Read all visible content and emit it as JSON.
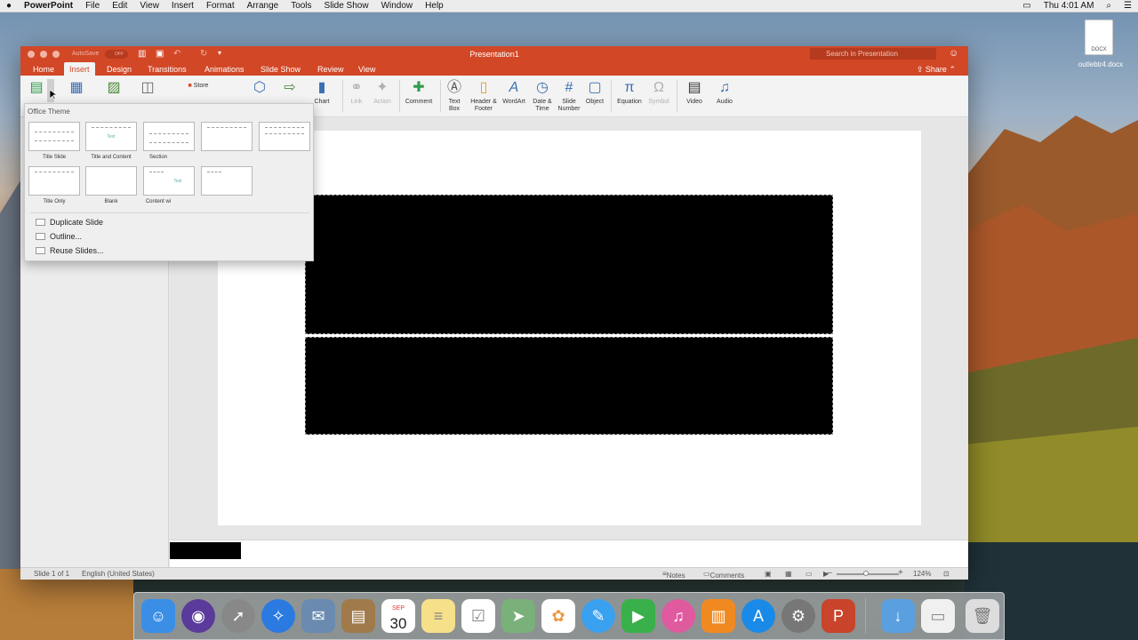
{
  "menubar": {
    "apple": "",
    "app": "PowerPoint",
    "items": [
      "File",
      "Edit",
      "View",
      "Insert",
      "Format",
      "Arrange",
      "Tools",
      "Slide Show",
      "Window",
      "Help"
    ],
    "time": "Thu 4:01 AM"
  },
  "window": {
    "title": "Presentation1",
    "autosave_label": "AutoSave",
    "autosave_state": "OFF",
    "search_placeholder": "Search in Presentation",
    "share_label": "Share",
    "accent": "#d24726"
  },
  "tabs": [
    {
      "label": "Home"
    },
    {
      "label": "Insert",
      "active": true
    },
    {
      "label": "Design"
    },
    {
      "label": "Transitions"
    },
    {
      "label": "Animations"
    },
    {
      "label": "Slide Show"
    },
    {
      "label": "Review"
    },
    {
      "label": "View"
    }
  ],
  "ribbon": {
    "store": "Store",
    "chart": "Chart",
    "link": "Link",
    "action": "Action",
    "comment": "Comment",
    "textbox": "Text\nBox",
    "textbox_l1": "Text",
    "textbox_l2": "Box",
    "header_l1": "Header &",
    "header_l2": "Footer",
    "wordart": "WordArt",
    "datetime_l1": "Date &",
    "datetime_l2": "Time",
    "slidenum_l1": "Slide",
    "slidenum_l2": "Number",
    "object": "Object",
    "equation": "Equation",
    "symbol": "Symbol",
    "video": "Video",
    "audio": "Audio"
  },
  "dropdown": {
    "title": "Office Theme",
    "layouts": [
      {
        "label": "Title Slide"
      },
      {
        "label": "Title and Content",
        "text": "Text"
      },
      {
        "label": "Section"
      },
      {
        "label": ""
      },
      {
        "label": ""
      },
      {
        "label": "Title Only"
      },
      {
        "label": "Blank"
      },
      {
        "label": "Content wi",
        "text": "Text"
      },
      {
        "label": ""
      }
    ],
    "actions": [
      "Duplicate Slide",
      "Outline...",
      "Reuse Slides..."
    ]
  },
  "status": {
    "slide": "Slide 1 of 1",
    "language": "English (United States)",
    "notes": "Notes",
    "comments": "Comments",
    "zoom": "124%"
  },
  "desktop": {
    "file_ext": "DOCX",
    "file_name": "outlebtr4.docx"
  },
  "dock": {
    "calendar_month": "SEP",
    "calendar_day": "30"
  }
}
